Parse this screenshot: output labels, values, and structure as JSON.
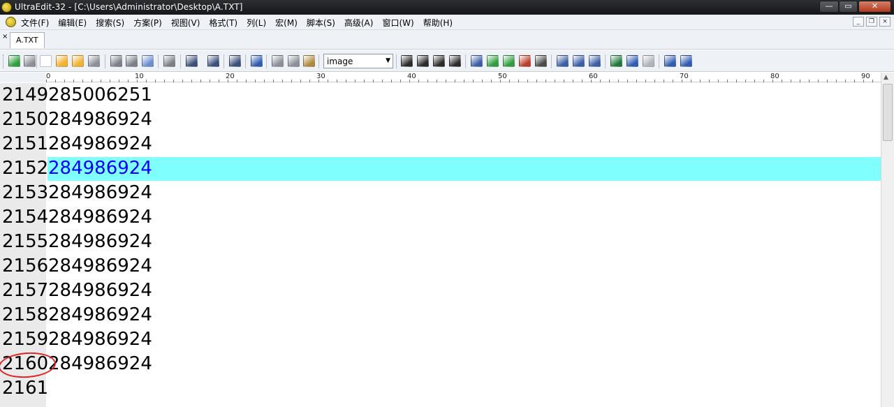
{
  "window": {
    "title": "UltraEdit-32 - [C:\\Users\\Administrator\\Desktop\\A.TXT]",
    "minimize": "—",
    "maximize": "▭",
    "close": "✕"
  },
  "menu": {
    "items": [
      "文件(F)",
      "编辑(E)",
      "搜索(S)",
      "方案(P)",
      "视图(V)",
      "格式(T)",
      "列(L)",
      "宏(M)",
      "脚本(S)",
      "高级(A)",
      "窗口(W)",
      "帮助(H)"
    ],
    "mdi_minimize": "_",
    "mdi_restore": "❐",
    "mdi_close": "×"
  },
  "tabs": {
    "close_glyph": "×",
    "active_file": "A.TXT"
  },
  "toolbar": {
    "combo_value": "image",
    "combo_arrow": "▼",
    "icons": [
      {
        "name": "back-icon",
        "color": "#2f9e3c"
      },
      {
        "name": "forward-icon",
        "color": "#8c9097"
      },
      {
        "name": "new-file-icon",
        "color": "#ffffff"
      },
      {
        "name": "open-folder-icon",
        "color": "#f2b02d"
      },
      {
        "name": "open-recent-icon",
        "color": "#f2b02d"
      },
      {
        "name": "save-icon",
        "color": "#8a8f98"
      },
      {
        "name": "print-icon",
        "color": "#7a7f88"
      },
      {
        "name": "print-preview-icon",
        "color": "#7a7f88"
      },
      {
        "name": "hex-edit-icon",
        "color": "#6a8fd0"
      },
      {
        "name": "properties-icon",
        "color": "#7a7f88"
      },
      {
        "name": "word-wrap-icon",
        "color": "#3b4f7a"
      },
      {
        "name": "line-numbers-icon",
        "color": "#3b4f7a"
      },
      {
        "name": "list-icon",
        "color": "#3b4f7a"
      },
      {
        "name": "browser-icon",
        "color": "#2f5cb3"
      },
      {
        "name": "cut-icon",
        "color": "#8a8f98"
      },
      {
        "name": "copy-icon",
        "color": "#8a8f98"
      },
      {
        "name": "paste-icon",
        "color": "#b08a3a"
      }
    ],
    "icons2": [
      {
        "name": "align-left-icon",
        "color": "#2b2b2b"
      },
      {
        "name": "align-center-icon",
        "color": "#2b2b2b"
      },
      {
        "name": "align-right-icon",
        "color": "#2b2b2b"
      },
      {
        "name": "justify-icon",
        "color": "#2b2b2b"
      },
      {
        "name": "find-icon",
        "color": "#3a5fa8"
      },
      {
        "name": "find-next-icon",
        "color": "#2f9e3c"
      },
      {
        "name": "find-prev-icon",
        "color": "#2f9e3c"
      },
      {
        "name": "replace-icon",
        "color": "#c03a2b"
      },
      {
        "name": "find-in-files-icon",
        "color": "#4a4a4a"
      },
      {
        "name": "split-horizontal-icon",
        "color": "#3a5fa8"
      },
      {
        "name": "split-vertical-icon",
        "color": "#3a5fa8"
      },
      {
        "name": "cascade-icon",
        "color": "#3a5fa8"
      },
      {
        "name": "globe-icon",
        "color": "#1f7a3a"
      },
      {
        "name": "ftp-icon",
        "color": "#2f5cb3"
      },
      {
        "name": "document-icon",
        "color": "#b0b4bb"
      },
      {
        "name": "info-icon",
        "color": "#2f5cb3"
      },
      {
        "name": "help-icon",
        "color": "#2f5cb3"
      }
    ]
  },
  "ruler": {
    "marks": [
      "0",
      "10",
      "20",
      "30",
      "40",
      "50",
      "60",
      "70",
      "80",
      "90"
    ]
  },
  "editor": {
    "current_line": "2152",
    "lines": [
      {
        "num": "2149",
        "text": "285006251"
      },
      {
        "num": "2150",
        "text": "284986924"
      },
      {
        "num": "2151",
        "text": "284986924"
      },
      {
        "num": "2152",
        "text": "284986924"
      },
      {
        "num": "2153",
        "text": "284986924"
      },
      {
        "num": "2154",
        "text": "284986924"
      },
      {
        "num": "2155",
        "text": "284986924"
      },
      {
        "num": "2156",
        "text": "284986924"
      },
      {
        "num": "2157",
        "text": "284986924"
      },
      {
        "num": "2158",
        "text": "284986924"
      },
      {
        "num": "2159",
        "text": "284986924"
      },
      {
        "num": "2160",
        "text": "284986924"
      },
      {
        "num": "2161",
        "text": ""
      }
    ],
    "highlight_color": "#80ffff",
    "annotation_color": "#e02020"
  },
  "scrollbar": {
    "up_arrow": "▲"
  }
}
